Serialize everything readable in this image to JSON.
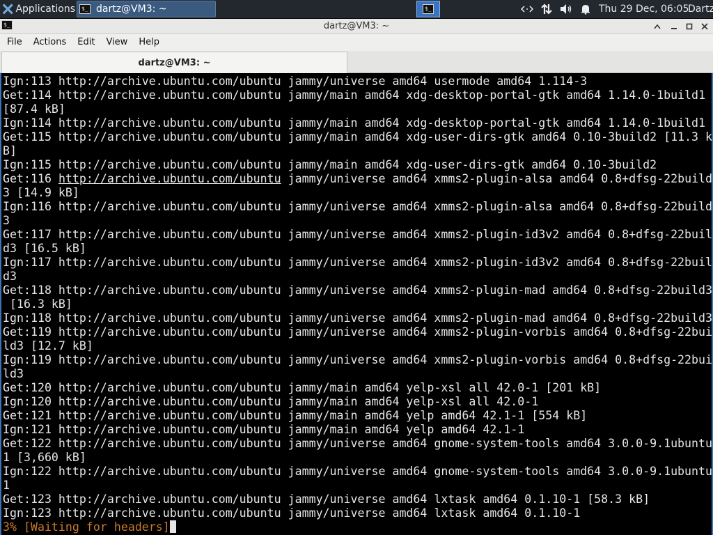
{
  "panel": {
    "applications_label": "Applications",
    "task_title": "dartz@VM3: ~",
    "clock": "Thu 29 Dec, 06:05",
    "user": "Dartz"
  },
  "window": {
    "title": "dartz@VM3: ~",
    "tab_title": "dartz@VM3: ~"
  },
  "menu": {
    "file": "File",
    "actions": "Actions",
    "edit": "Edit",
    "view": "View",
    "help": "Help"
  },
  "terminal": {
    "lines": [
      "Ign:113 http://archive.ubuntu.com/ubuntu jammy/universe amd64 usermode amd64 1.114-3",
      "Get:114 http://archive.ubuntu.com/ubuntu jammy/main amd64 xdg-desktop-portal-gtk amd64 1.14.0-1build1",
      "[87.4 kB]",
      "Ign:114 http://archive.ubuntu.com/ubuntu jammy/main amd64 xdg-desktop-portal-gtk amd64 1.14.0-1build1",
      "Get:115 http://archive.ubuntu.com/ubuntu jammy/main amd64 xdg-user-dirs-gtk amd64 0.10-3build2 [11.3 k",
      "B]",
      "Ign:115 http://archive.ubuntu.com/ubuntu jammy/main amd64 xdg-user-dirs-gtk amd64 0.10-3build2",
      "Get:116 http://archive.ubuntu.com/ubuntu jammy/universe amd64 xmms2-plugin-alsa amd64 0.8+dfsg-22build",
      "3 [14.9 kB]",
      "Ign:116 http://archive.ubuntu.com/ubuntu jammy/universe amd64 xmms2-plugin-alsa amd64 0.8+dfsg-22build",
      "3",
      "Get:117 http://archive.ubuntu.com/ubuntu jammy/universe amd64 xmms2-plugin-id3v2 amd64 0.8+dfsg-22buil",
      "d3 [16.5 kB]",
      "Ign:117 http://archive.ubuntu.com/ubuntu jammy/universe amd64 xmms2-plugin-id3v2 amd64 0.8+dfsg-22buil",
      "d3",
      "Get:118 http://archive.ubuntu.com/ubuntu jammy/universe amd64 xmms2-plugin-mad amd64 0.8+dfsg-22build3",
      " [16.3 kB]",
      "Ign:118 http://archive.ubuntu.com/ubuntu jammy/universe amd64 xmms2-plugin-mad amd64 0.8+dfsg-22build3",
      "Get:119 http://archive.ubuntu.com/ubuntu jammy/universe amd64 xmms2-plugin-vorbis amd64 0.8+dfsg-22bui",
      "ld3 [12.7 kB]",
      "Ign:119 http://archive.ubuntu.com/ubuntu jammy/universe amd64 xmms2-plugin-vorbis amd64 0.8+dfsg-22bui",
      "ld3",
      "Get:120 http://archive.ubuntu.com/ubuntu jammy/main amd64 yelp-xsl all 42.0-1 [201 kB]",
      "Ign:120 http://archive.ubuntu.com/ubuntu jammy/main amd64 yelp-xsl all 42.0-1",
      "Get:121 http://archive.ubuntu.com/ubuntu jammy/main amd64 yelp amd64 42.1-1 [554 kB]",
      "Ign:121 http://archive.ubuntu.com/ubuntu jammy/main amd64 yelp amd64 42.1-1",
      "Get:122 http://archive.ubuntu.com/ubuntu jammy/universe amd64 gnome-system-tools amd64 3.0.0-9.1ubuntu",
      "1 [3,660 kB]",
      "Ign:122 http://archive.ubuntu.com/ubuntu jammy/universe amd64 gnome-system-tools amd64 3.0.0-9.1ubuntu",
      "1",
      "Get:123 http://archive.ubuntu.com/ubuntu jammy/universe amd64 lxtask amd64 0.1.10-1 [58.3 kB]",
      "Ign:123 http://archive.ubuntu.com/ubuntu jammy/universe amd64 lxtask amd64 0.1.10-1"
    ],
    "link_line_index": 7,
    "link_prefix": "Get:116 ",
    "link_text": "http://archive.ubuntu.com/ubuntu",
    "link_suffix": " jammy/universe amd64 xmms2-plugin-alsa amd64 0.8+dfsg-22build",
    "progress": "3% [Waiting for headers]"
  }
}
